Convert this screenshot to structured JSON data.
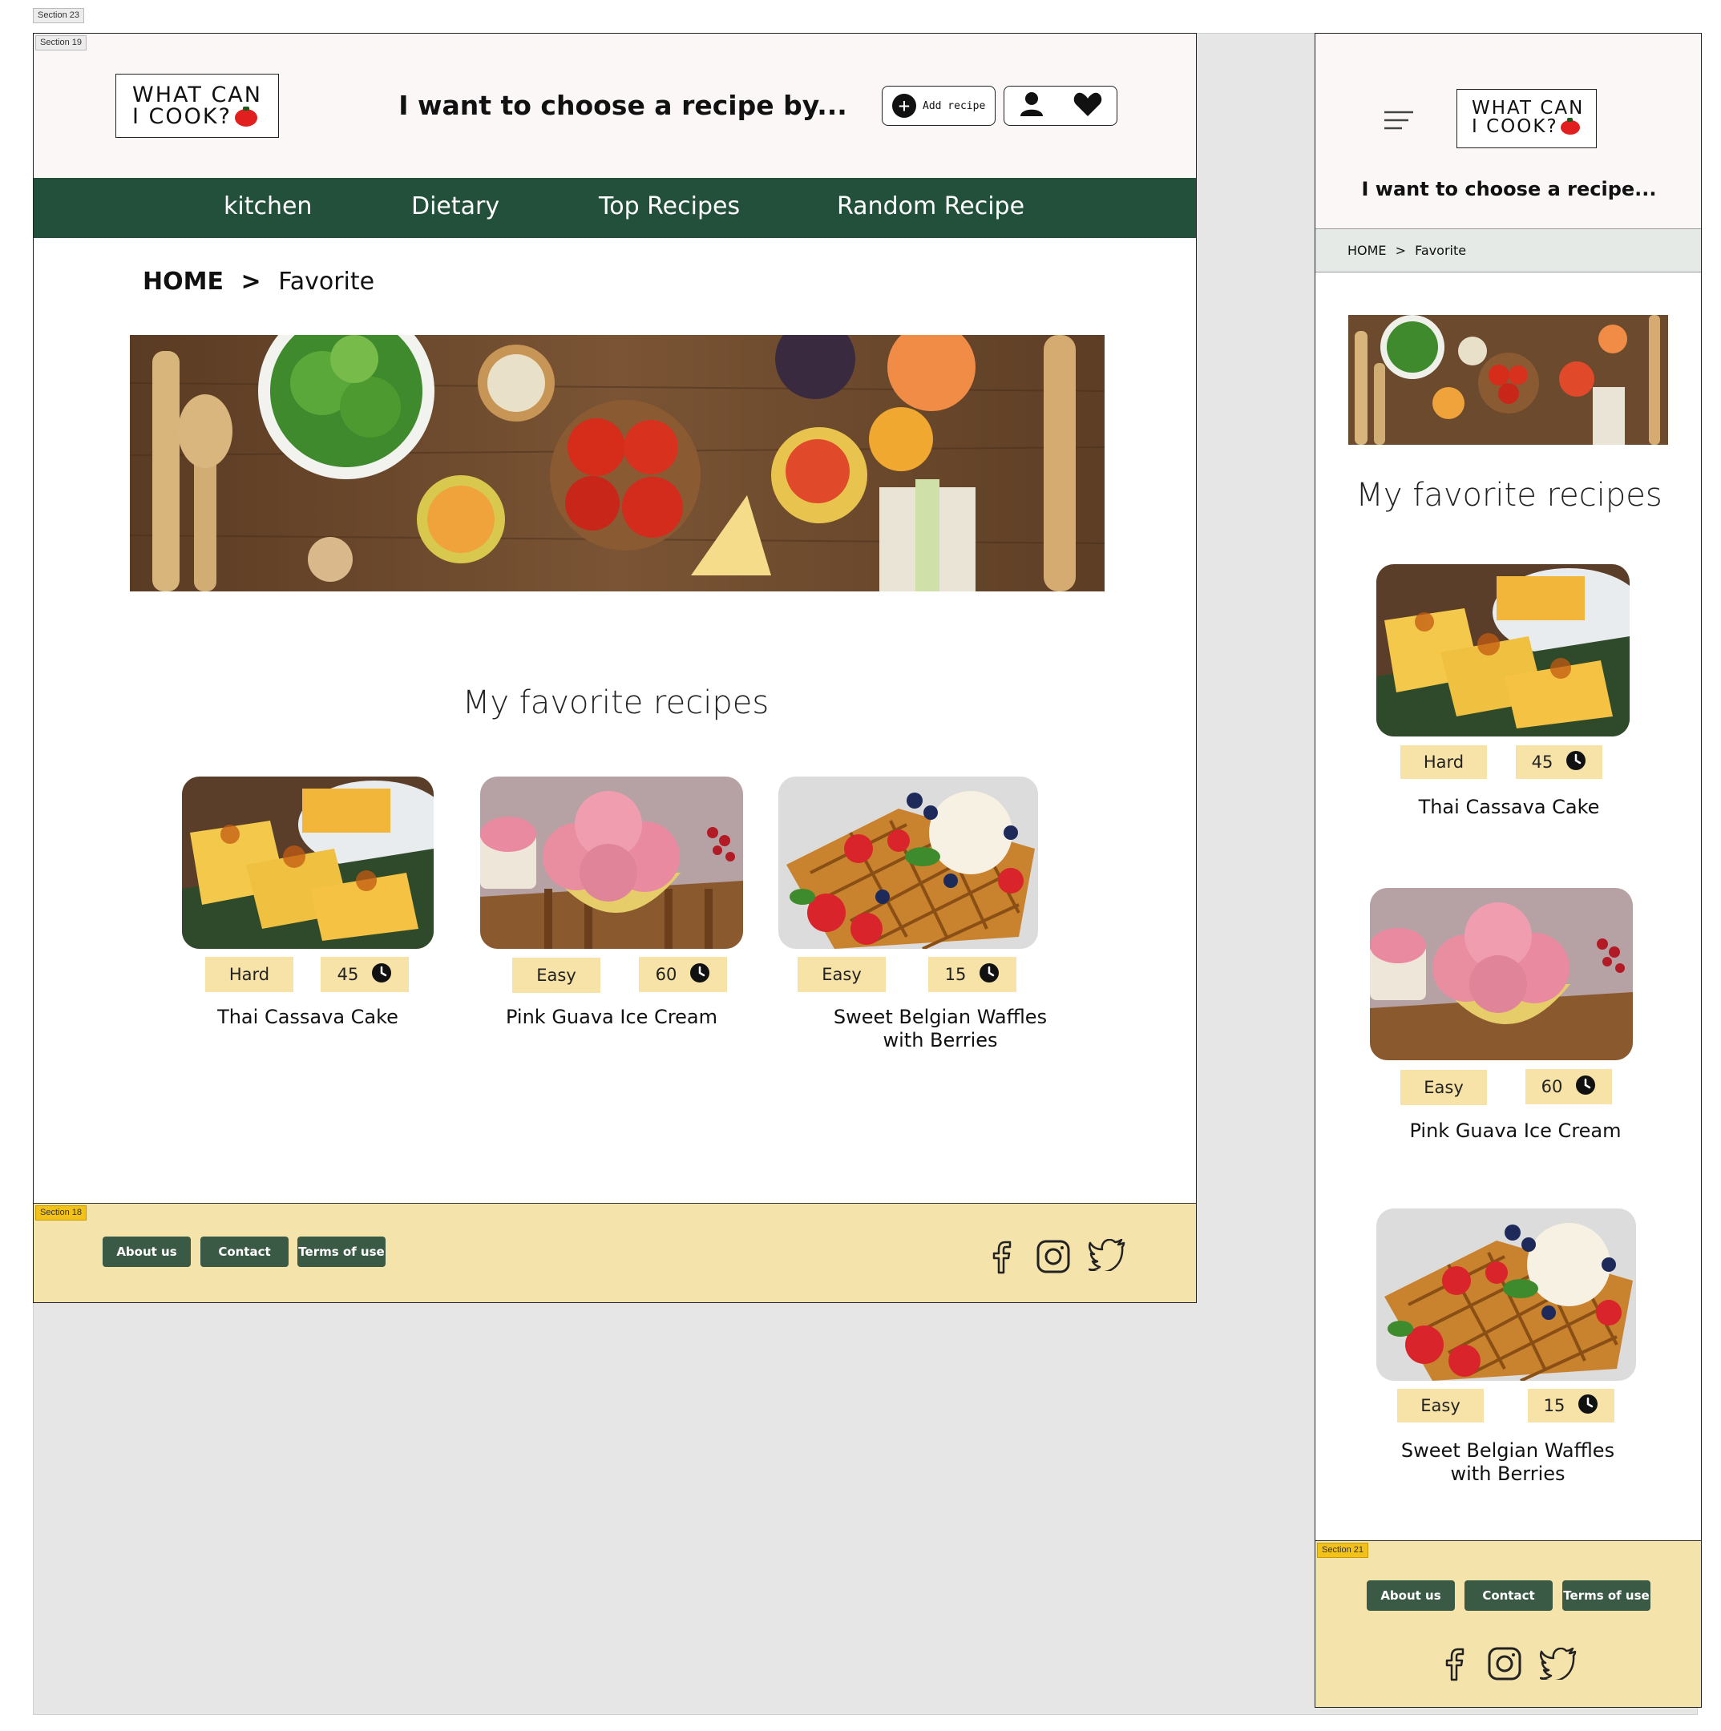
{
  "section_tags": {
    "canvas": "Section 23",
    "desktop": "Section 19",
    "desktop_footer": "Section 18",
    "mobile_footer": "Section 21"
  },
  "brand": {
    "logo_line1": "WHAT CAN",
    "logo_line2": "I COOK?",
    "accent_green": "#23503b",
    "footer_yellow": "#f5e3ac",
    "tag_yellow": "#f7e3a8",
    "tomato_red": "#e11f1f"
  },
  "header": {
    "tagline_desktop": "I want to choose a recipe by...",
    "tagline_mobile": "I want to choose a recipe...",
    "add_recipe_label": "Add recipe",
    "icons": [
      "plus-circle-icon",
      "user-icon",
      "heart-icon",
      "hamburger-menu-icon"
    ]
  },
  "nav": {
    "items": [
      "kitchen",
      "Dietary",
      "Top Recipes",
      "Random Recipe"
    ]
  },
  "breadcrumb": {
    "home": "HOME",
    "separator": ">",
    "current": "Favorite"
  },
  "favorites": {
    "title": "My favorite recipes",
    "recipes": [
      {
        "name": "Thai Cassava Cake",
        "difficulty": "Hard",
        "time": "45"
      },
      {
        "name": "Pink Guava Ice Cream",
        "difficulty": "Easy",
        "time": "60"
      },
      {
        "name": "Sweet Belgian Waffles with Berries",
        "difficulty": "Easy",
        "time": "15"
      }
    ]
  },
  "footer": {
    "links": [
      "About us",
      "Contact",
      "Terms of use"
    ],
    "social_icons": [
      "facebook-icon",
      "instagram-icon",
      "twitter-icon"
    ]
  }
}
